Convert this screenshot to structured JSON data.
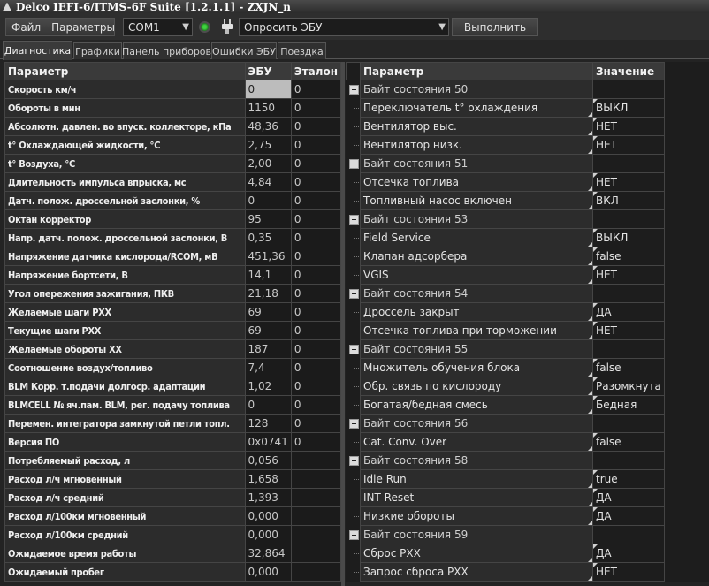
{
  "window": {
    "title": "Delco IEFI-6/ITMS-6F Suite [1.2.1.1] - ZXJN_n"
  },
  "menu": {
    "file": "Файл",
    "params": "Параметры"
  },
  "toolbar": {
    "port": "COM1",
    "request": "Опросить ЭБУ",
    "execute": "Выполнить",
    "led_color": "#3fd23f"
  },
  "tabs": [
    "Диагностика",
    "Графики",
    "Панель приборов",
    "Ошибки ЭБУ",
    "Поездка"
  ],
  "left_table": {
    "headers": [
      "Параметр",
      "ЭБУ",
      "Эталон"
    ],
    "rows": [
      [
        "Скорость км/ч",
        "0",
        "0"
      ],
      [
        "Обороты в мин",
        "1150",
        "0"
      ],
      [
        "Абсолютн. давлен. во впуск. коллекторе, кПа",
        "48,36",
        "0"
      ],
      [
        "t° Охлаждающей жидкости, °С",
        "2,75",
        "0"
      ],
      [
        "t° Воздуха, °С",
        "2,00",
        "0"
      ],
      [
        "Длительность импульса впрыска, мс",
        "4,84",
        "0"
      ],
      [
        "Датч. полож. дроссельной заслонки, %",
        "0",
        "0"
      ],
      [
        "Октан корректор",
        "95",
        "0"
      ],
      [
        "Напр. датч. полож. дроссельной заслонки, В",
        "0,35",
        "0"
      ],
      [
        "Напряжение датчика кислорода/RCOM, мВ",
        "451,36",
        "0"
      ],
      [
        "Напряжение бортсети, В",
        "14,1",
        "0"
      ],
      [
        "Угол опережения зажигания, ПКВ",
        "21,18",
        "0"
      ],
      [
        "Желаемые шаги РХХ",
        "69",
        "0"
      ],
      [
        "Текущие шаги РХХ",
        "69",
        "0"
      ],
      [
        "Желаемые обороты ХХ",
        "187",
        "0"
      ],
      [
        "Соотношение воздух/топливо",
        "7,4",
        "0"
      ],
      [
        "BLM Корр. т.подачи долгоср. адаптации",
        "1,02",
        "0"
      ],
      [
        "BLMCELL № яч.пам. BLM, рег. подачу топлива",
        "0",
        "0"
      ],
      [
        "Перемен. интегратора замкнутой петли топл.",
        "128",
        "0"
      ],
      [
        "Версия ПО",
        "0x0741",
        "0"
      ],
      [
        "Потребляемый расход, л",
        "0,056",
        ""
      ],
      [
        "Расход л/ч мгновенный",
        "1,658",
        ""
      ],
      [
        "Расход л/ч средний",
        "1,393",
        ""
      ],
      [
        "Расход л/100км мгновенный",
        "0,000",
        ""
      ],
      [
        "Расход л/100км средний",
        "0,000",
        ""
      ],
      [
        "Ожидаемое время работы",
        "32,864",
        ""
      ],
      [
        "Ожидаемый пробег",
        "0,000",
        ""
      ]
    ]
  },
  "right_table": {
    "headers": [
      "Параметр",
      "Значение"
    ],
    "rows": [
      {
        "p": "Байт состояния 50",
        "v": "",
        "group": true
      },
      {
        "p": "Переключатель t° охлаждения",
        "v": "ВЫКЛ"
      },
      {
        "p": "Вентилятор выс.",
        "v": "НЕТ"
      },
      {
        "p": "Вентилятор низк.",
        "v": "НЕТ"
      },
      {
        "p": "Байт состояния 51",
        "v": "",
        "group": true
      },
      {
        "p": "Отсечка топлива",
        "v": "НЕТ"
      },
      {
        "p": "Топливный насос включен",
        "v": "ВКЛ"
      },
      {
        "p": "Байт состояния 53",
        "v": "",
        "group": true
      },
      {
        "p": "Field Service",
        "v": "ВЫКЛ"
      },
      {
        "p": "Клапан адсорбера",
        "v": "false"
      },
      {
        "p": "VGIS",
        "v": "НЕТ"
      },
      {
        "p": "Байт состояния 54",
        "v": "",
        "group": true
      },
      {
        "p": "Дроссель закрыт",
        "v": "ДА"
      },
      {
        "p": "Отсечка топлива при торможении",
        "v": "НЕТ"
      },
      {
        "p": "Байт состояния 55",
        "v": "",
        "group": true
      },
      {
        "p": "Множитель обучения блока",
        "v": "false"
      },
      {
        "p": "Обр. связь по кислороду",
        "v": "Разомкнута"
      },
      {
        "p": "Богатая/бедная смесь",
        "v": "Бедная"
      },
      {
        "p": "Байт состояния 56",
        "v": "",
        "group": true
      },
      {
        "p": "Cat. Conv. Over",
        "v": "false"
      },
      {
        "p": "Байт состояния 58",
        "v": "",
        "group": true
      },
      {
        "p": "Idle Run",
        "v": "true"
      },
      {
        "p": "INT Reset",
        "v": "ДА"
      },
      {
        "p": "Низкие обороты",
        "v": "ДА"
      },
      {
        "p": "Байт состояния 59",
        "v": "",
        "group": true
      },
      {
        "p": "Сброс РХХ",
        "v": "ДА"
      },
      {
        "p": "Запрос сброса РХХ",
        "v": "НЕТ"
      }
    ]
  }
}
